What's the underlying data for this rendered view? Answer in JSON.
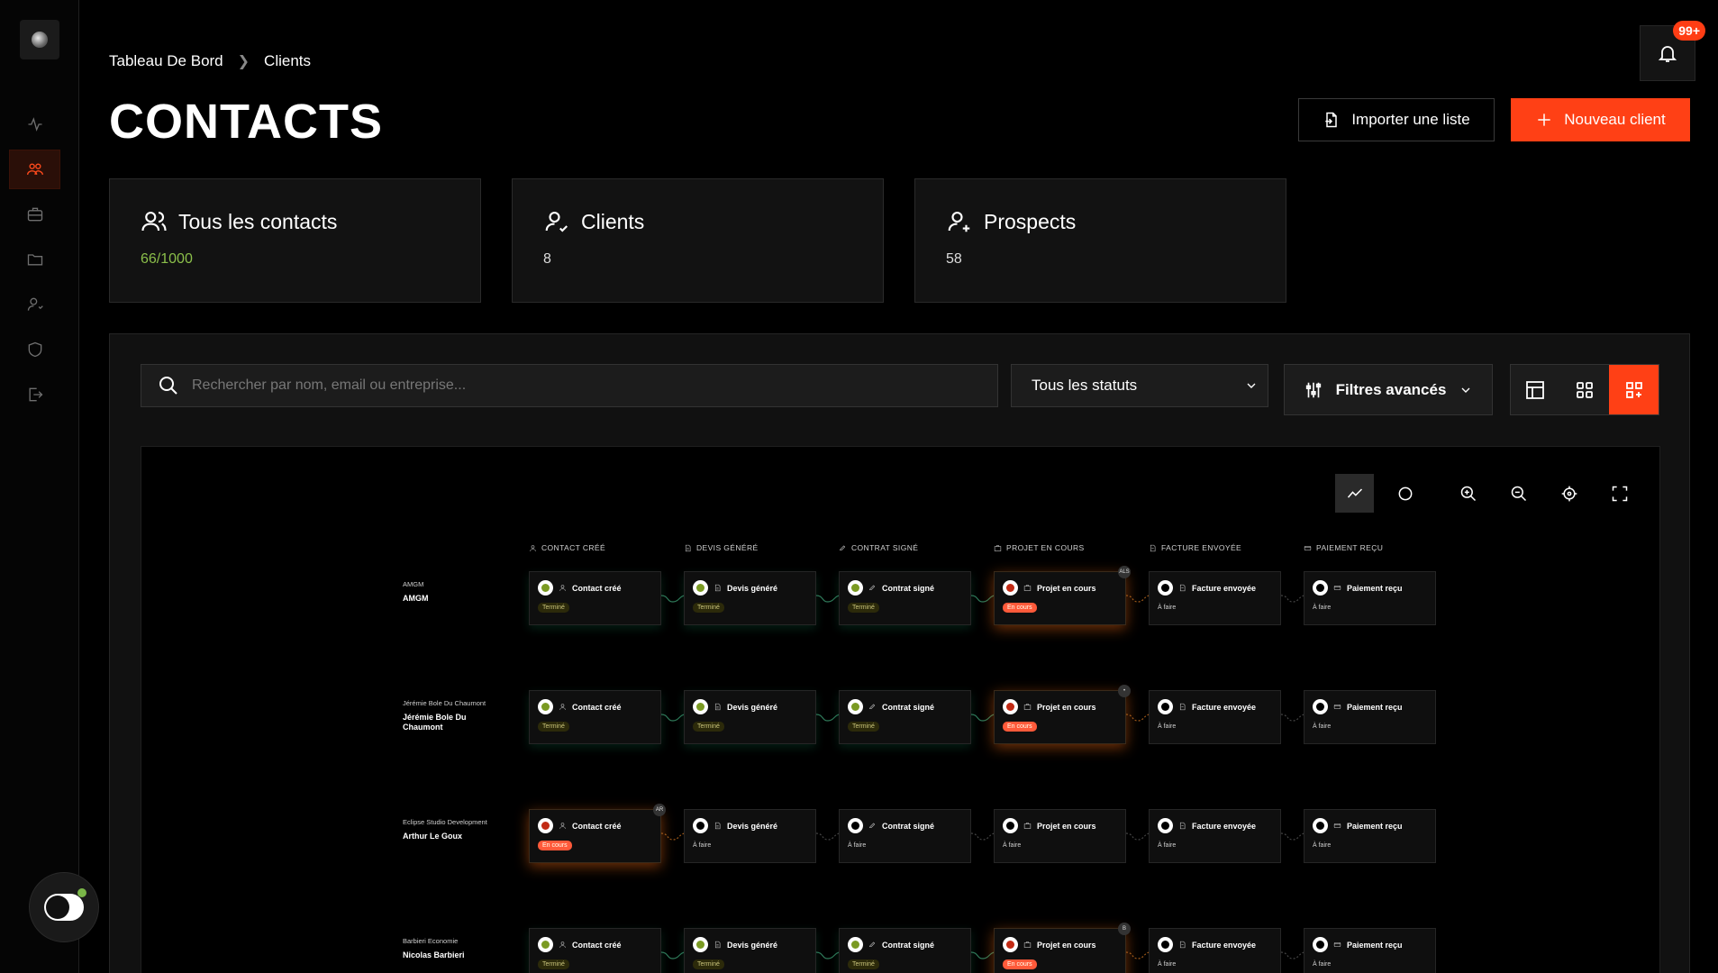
{
  "breadcrumb": {
    "home": "Tableau De Bord",
    "current": "Clients"
  },
  "page_title": "CONTACTS",
  "notifications": {
    "badge": "99+"
  },
  "actions": {
    "import_label": "Importer une liste",
    "new_label": "Nouveau client"
  },
  "stats": [
    {
      "label": "Tous les contacts",
      "value": "66/1000"
    },
    {
      "label": "Clients",
      "value": "8"
    },
    {
      "label": "Prospects",
      "value": "58"
    }
  ],
  "search": {
    "placeholder": "Rechercher par nom, email ou entreprise..."
  },
  "status_filter": {
    "selected": "Tous les statuts"
  },
  "advanced_filters_label": "Filtres avancés",
  "columns": [
    "Contact créé",
    "Devis généré",
    "Contrat signé",
    "Projet en cours",
    "Facture envoyée",
    "Paiement reçu"
  ],
  "rows": [
    {
      "company": "AMGM",
      "contact": "AMGM",
      "steps": [
        {
          "title": "Contact créé",
          "status": "done",
          "tag": "Terminé"
        },
        {
          "title": "Devis généré",
          "status": "done",
          "tag": "Terminé"
        },
        {
          "title": "Contrat signé",
          "status": "done",
          "tag": "Terminé"
        },
        {
          "title": "Projet en cours",
          "status": "progress",
          "tag": "En cours",
          "avatar": "ALS"
        },
        {
          "title": "Facture envoyée",
          "status": "todo",
          "tag": "À faire"
        },
        {
          "title": "Paiement reçu",
          "status": "todo",
          "tag": "À faire"
        }
      ]
    },
    {
      "company": "Jérémie Bole Du Chaumont",
      "contact": "Jérémie Bole Du Chaumont",
      "steps": [
        {
          "title": "Contact créé",
          "status": "done",
          "tag": "Terminé"
        },
        {
          "title": "Devis généré",
          "status": "done",
          "tag": "Terminé"
        },
        {
          "title": "Contrat signé",
          "status": "done",
          "tag": "Terminé"
        },
        {
          "title": "Projet en cours",
          "status": "progress",
          "tag": "En cours",
          "avatar": "•"
        },
        {
          "title": "Facture envoyée",
          "status": "todo",
          "tag": "À faire"
        },
        {
          "title": "Paiement reçu",
          "status": "todo",
          "tag": "À faire"
        }
      ]
    },
    {
      "company": "Eclipse Studio Development",
      "contact": "Arthur Le Goux",
      "steps": [
        {
          "title": "Contact créé",
          "status": "progress",
          "tag": "En cours",
          "avatar": "AR"
        },
        {
          "title": "Devis généré",
          "status": "todo",
          "tag": "À faire"
        },
        {
          "title": "Contrat signé",
          "status": "todo",
          "tag": "À faire"
        },
        {
          "title": "Projet en cours",
          "status": "todo",
          "tag": "À faire"
        },
        {
          "title": "Facture envoyée",
          "status": "todo",
          "tag": "À faire"
        },
        {
          "title": "Paiement reçu",
          "status": "todo",
          "tag": "À faire"
        }
      ]
    },
    {
      "company": "Barbieri Economie",
      "contact": "Nicolas Barbieri",
      "steps": [
        {
          "title": "Contact créé",
          "status": "done",
          "tag": "Terminé"
        },
        {
          "title": "Devis généré",
          "status": "done",
          "tag": "Terminé"
        },
        {
          "title": "Contrat signé",
          "status": "done",
          "tag": "Terminé"
        },
        {
          "title": "Projet en cours",
          "status": "progress",
          "tag": "En cours",
          "avatar": "B"
        },
        {
          "title": "Facture envoyée",
          "status": "todo",
          "tag": "À faire"
        },
        {
          "title": "Paiement reçu",
          "status": "todo",
          "tag": "À faire"
        }
      ]
    }
  ],
  "colors": {
    "accent": "#ff4015",
    "done": "#7a9a22",
    "progress": "#c22a14"
  }
}
